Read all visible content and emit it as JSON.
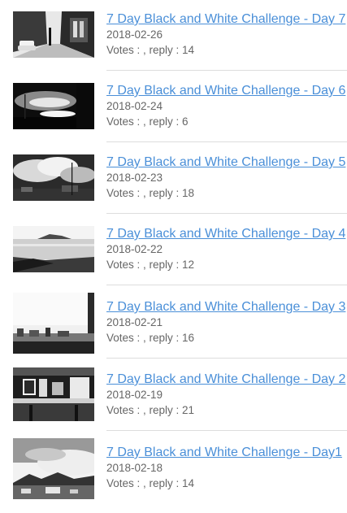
{
  "posts": [
    {
      "title": "7 Day Black and White Challenge - Day 7",
      "date": "2018-02-26",
      "votes_label": "Votes : , reply : ",
      "reply": "14",
      "meta": "Votes : , reply : 14",
      "thumb": "street-photo-thumbnail"
    },
    {
      "title": "7 Day Black and White Challenge - Day 6",
      "date": "2018-02-24",
      "meta": "Votes : , reply : 6",
      "thumb": "sunset-sky-thumbnail"
    },
    {
      "title": "7 Day Black and White Challenge - Day 5",
      "date": "2018-02-23",
      "meta": "Votes : , reply : 18",
      "thumb": "clouds-town-thumbnail"
    },
    {
      "title": "7 Day Black and White Challenge - Day 4",
      "date": "2018-02-22",
      "meta": "Votes : , reply : 12",
      "thumb": "seaside-thumbnail"
    },
    {
      "title": "7 Day Black and White Challenge - Day 3",
      "date": "2018-02-21",
      "meta": "Votes : , reply : 16",
      "thumb": "city-skyline-thumbnail"
    },
    {
      "title": "7 Day Black and White Challenge - Day 2",
      "date": "2018-02-19",
      "meta": "Votes : , reply : 21",
      "thumb": "computer-desk-thumbnail"
    },
    {
      "title": "7 Day Black and White Challenge - Day1",
      "date": "2018-02-18",
      "meta": "Votes : , reply : 14",
      "thumb": "mountain-city-thumbnail"
    }
  ]
}
